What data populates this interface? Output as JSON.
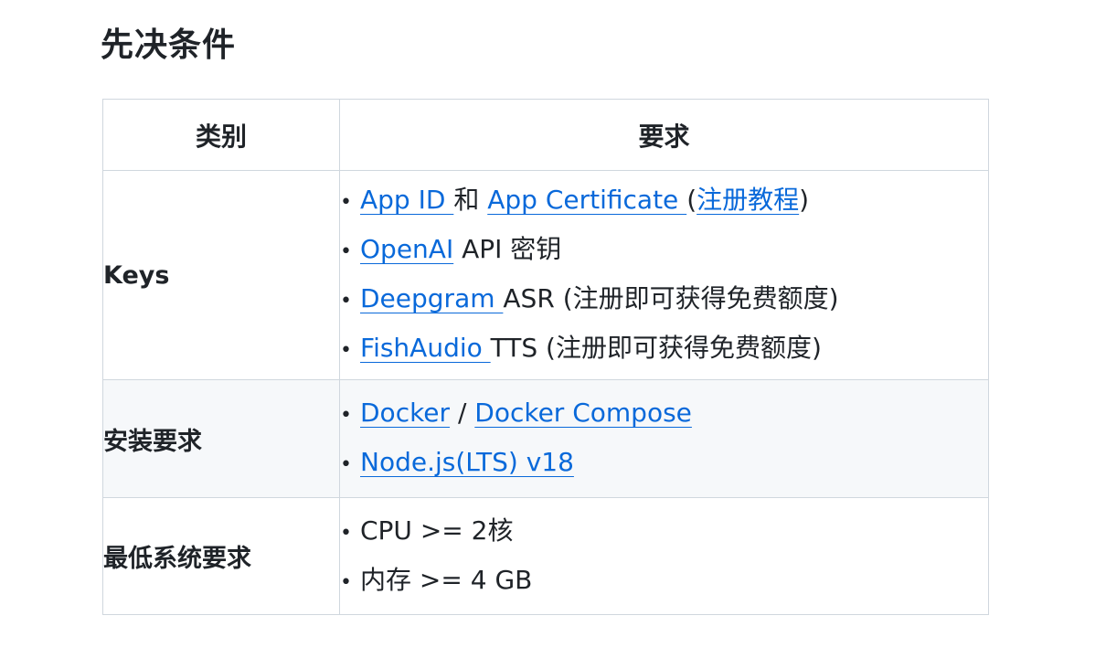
{
  "title": "先决条件",
  "table": {
    "headers": [
      "类别",
      "要求"
    ],
    "rows": [
      {
        "category": "Keys",
        "items": [
          {
            "parts": [
              {
                "text": "App ID ",
                "link": true
              },
              {
                "text": "和 ",
                "link": false
              },
              {
                "text": "App Certificate ",
                "link": true
              },
              {
                "text": " (",
                "link": false
              },
              {
                "text": "注册教程",
                "link": true
              },
              {
                "text": ")",
                "link": false
              }
            ]
          },
          {
            "parts": [
              {
                "text": "OpenAI",
                "link": true
              },
              {
                "text": " API 密钥",
                "link": false
              }
            ]
          },
          {
            "parts": [
              {
                "text": "Deepgram ",
                "link": true
              },
              {
                "text": "ASR (注册即可获得免费额度)",
                "link": false
              }
            ]
          },
          {
            "parts": [
              {
                "text": "FishAudio ",
                "link": true
              },
              {
                "text": "TTS (注册即可获得免费额度)",
                "link": false
              }
            ]
          }
        ]
      },
      {
        "category": "安装要求",
        "items": [
          {
            "parts": [
              {
                "text": "Docker",
                "link": true
              },
              {
                "text": " / ",
                "link": false
              },
              {
                "text": "Docker Compose",
                "link": true
              }
            ]
          },
          {
            "parts": [
              {
                "text": "Node.js(LTS) v18",
                "link": true
              }
            ]
          }
        ]
      },
      {
        "category": "最低系统要求",
        "items": [
          {
            "parts": [
              {
                "text": "CPU >= 2核",
                "link": false
              }
            ]
          },
          {
            "parts": [
              {
                "text": "内存 >= 4 GB",
                "link": false
              }
            ]
          }
        ]
      }
    ]
  }
}
